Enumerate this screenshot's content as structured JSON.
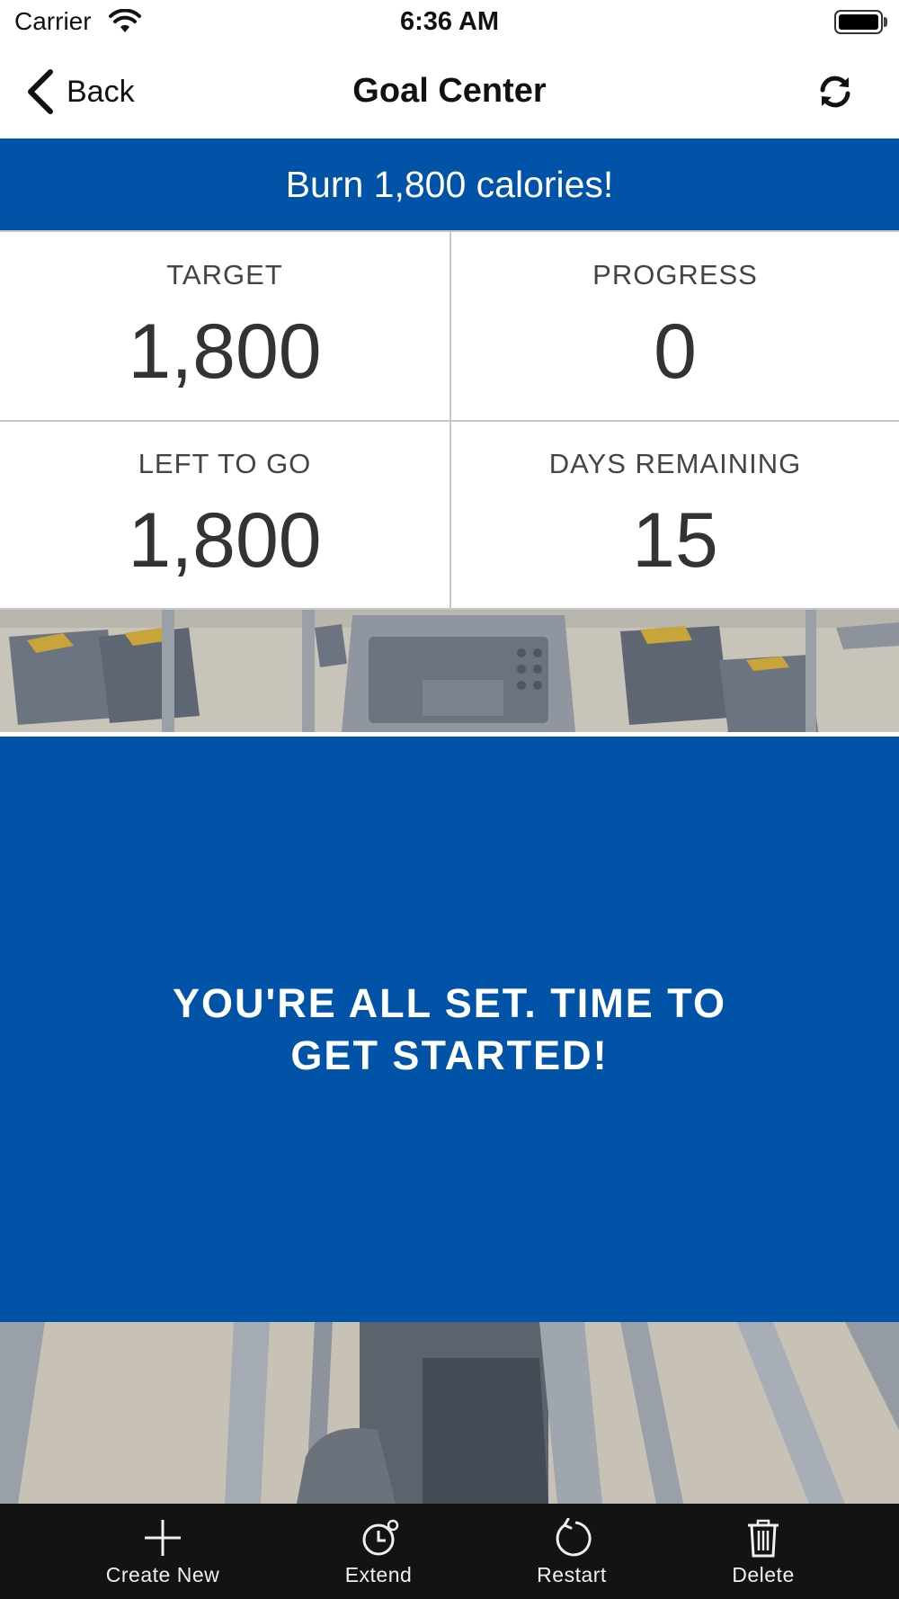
{
  "status_bar": {
    "carrier": "Carrier",
    "time": "6:36 AM"
  },
  "nav": {
    "back_label": "Back",
    "title": "Goal Center",
    "refresh_icon": "refresh-icon"
  },
  "banner": {
    "text": "Burn 1,800 calories!",
    "color": "#0053a6"
  },
  "stats": [
    {
      "label": "TARGET",
      "value": "1,800"
    },
    {
      "label": "PROGRESS",
      "value": "0"
    },
    {
      "label": "LEFT TO GO",
      "value": "1,800"
    },
    {
      "label": "DAYS REMAINING",
      "value": "15"
    }
  ],
  "message": {
    "text": "YOU'RE ALL SET. TIME TO GET STARTED!"
  },
  "tabs": [
    {
      "label": "Create New",
      "icon": "plus-icon"
    },
    {
      "label": "Extend",
      "icon": "alarm-clock-icon"
    },
    {
      "label": "Restart",
      "icon": "restart-icon"
    },
    {
      "label": "Delete",
      "icon": "trash-icon"
    }
  ],
  "colors": {
    "accent": "#0053a6",
    "tab_bar": "#131313"
  }
}
